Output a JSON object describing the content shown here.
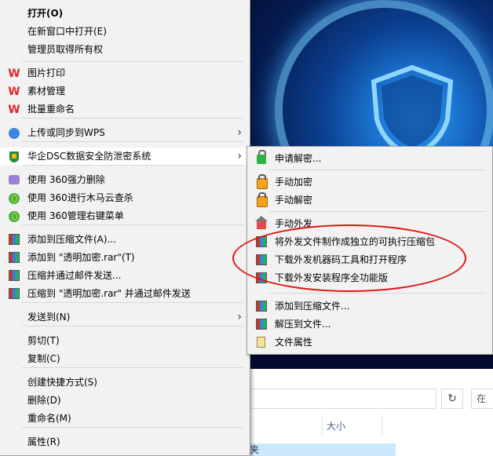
{
  "main_menu": {
    "items": [
      {
        "label": "打开(O)",
        "bold": true
      },
      {
        "label": "在新窗口中打开(E)"
      },
      {
        "label": "管理员取得所有权"
      },
      {
        "label": "图片打印",
        "icon": "wps-icon"
      },
      {
        "label": "素材管理",
        "icon": "wps-icon"
      },
      {
        "label": "批量重命名",
        "icon": "wps-icon"
      },
      {
        "label": "上传或同步到WPS",
        "icon": "cloud-upload-icon",
        "submenu": true
      },
      {
        "label": "华企DSC数据安全防泄密系统",
        "icon": "shield-icon",
        "submenu": true,
        "highlighted": true
      },
      {
        "label": "使用 360强力删除",
        "icon": "360-delete-icon"
      },
      {
        "label": "使用 360进行木马云查杀",
        "icon": "360-icon"
      },
      {
        "label": "使用 360管理右键菜单",
        "icon": "360-icon"
      },
      {
        "label": "添加到压缩文件(A)...",
        "icon": "winrar-icon"
      },
      {
        "label": "添加到 \"透明加密.rar\"(T)",
        "icon": "winrar-icon"
      },
      {
        "label": "压缩并通过邮件发送...",
        "icon": "winrar-icon"
      },
      {
        "label": "压缩到 \"透明加密.rar\" 并通过邮件发送",
        "icon": "winrar-icon"
      },
      {
        "label": "发送到(N)",
        "submenu": true
      },
      {
        "label": "剪切(T)"
      },
      {
        "label": "复制(C)"
      },
      {
        "label": "创建快捷方式(S)"
      },
      {
        "label": "删除(D)"
      },
      {
        "label": "重命名(M)"
      },
      {
        "label": "属性(R)"
      }
    ],
    "arrow_glyph": "›",
    "wps_glyph": "W"
  },
  "sub_menu": {
    "items": [
      {
        "label": "申请解密...",
        "icon": "unlock-request-icon"
      },
      {
        "label": "手动加密",
        "icon": "lock-icon"
      },
      {
        "label": "手动解密",
        "icon": "unlock-icon"
      },
      {
        "label": "手动外发",
        "icon": "house-icon"
      },
      {
        "label": "将外发文件制作成独立的可执行压缩包",
        "icon": "winrar-icon"
      },
      {
        "label": "下载外发机器码工具和打开程序",
        "icon": "winrar-icon"
      },
      {
        "label": "下载外发安装程序全功能版",
        "icon": "winrar-icon"
      },
      {
        "label": "添加到压缩文件...",
        "icon": "winrar-icon"
      },
      {
        "label": "解压到文件...",
        "icon": "winrar-icon"
      },
      {
        "label": "文件属性",
        "icon": "document-icon"
      }
    ]
  },
  "explorer": {
    "refresh_glyph": "↻",
    "search_placeholder": "在",
    "column_size": "大小",
    "row_fragment": "夹"
  },
  "colors": {
    "menu_bg": "#f2f2f2",
    "highlight_ellipse": "#e01010",
    "wps_red": "#e3262b"
  }
}
